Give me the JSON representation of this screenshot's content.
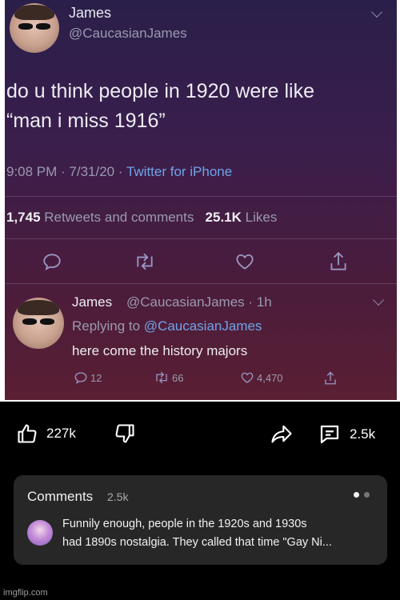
{
  "tweet": {
    "author_name": "James",
    "author_handle": "@CaucasianJames",
    "text_line1": "do u think people in 1920 were like",
    "text_line2": "“man i miss 1916”",
    "time": "9:08 PM · 7/31/20 · ",
    "source": "Twitter for iPhone",
    "retweets_count": "1,745",
    "retweets_label": "Retweets and comments",
    "likes_count": "25.1K",
    "likes_label": "Likes",
    "icons": [
      "reply-icon",
      "retweet-icon",
      "like-icon",
      "share-icon"
    ]
  },
  "reply": {
    "author_name": "James",
    "author_handle": "@CaucasianJames · 1h",
    "replying_prefix": "Replying to ",
    "replying_to": "@CaucasianJames",
    "text": "here come the history majors",
    "reply_count": "12",
    "retweet_count": "66",
    "like_count": "4,470"
  },
  "action_bar": {
    "like_count": "227k",
    "comments_count": "2.5k",
    "icons": [
      "thumbs-up-icon",
      "thumbs-down-icon",
      "share-icon",
      "comment-icon"
    ]
  },
  "comments_panel": {
    "title": "Comments",
    "count": "2.5k",
    "top_comment_line1": "Funnily enough, people in the 1920s and 1930s",
    "top_comment_line2": "had 1890s nostalgia. They called that time \"Gay Ni..."
  },
  "watermark": "imgflip.com",
  "colors": {
    "link": "#6fa3e8",
    "card_bg": "#272727",
    "page_bg": "#000000"
  }
}
